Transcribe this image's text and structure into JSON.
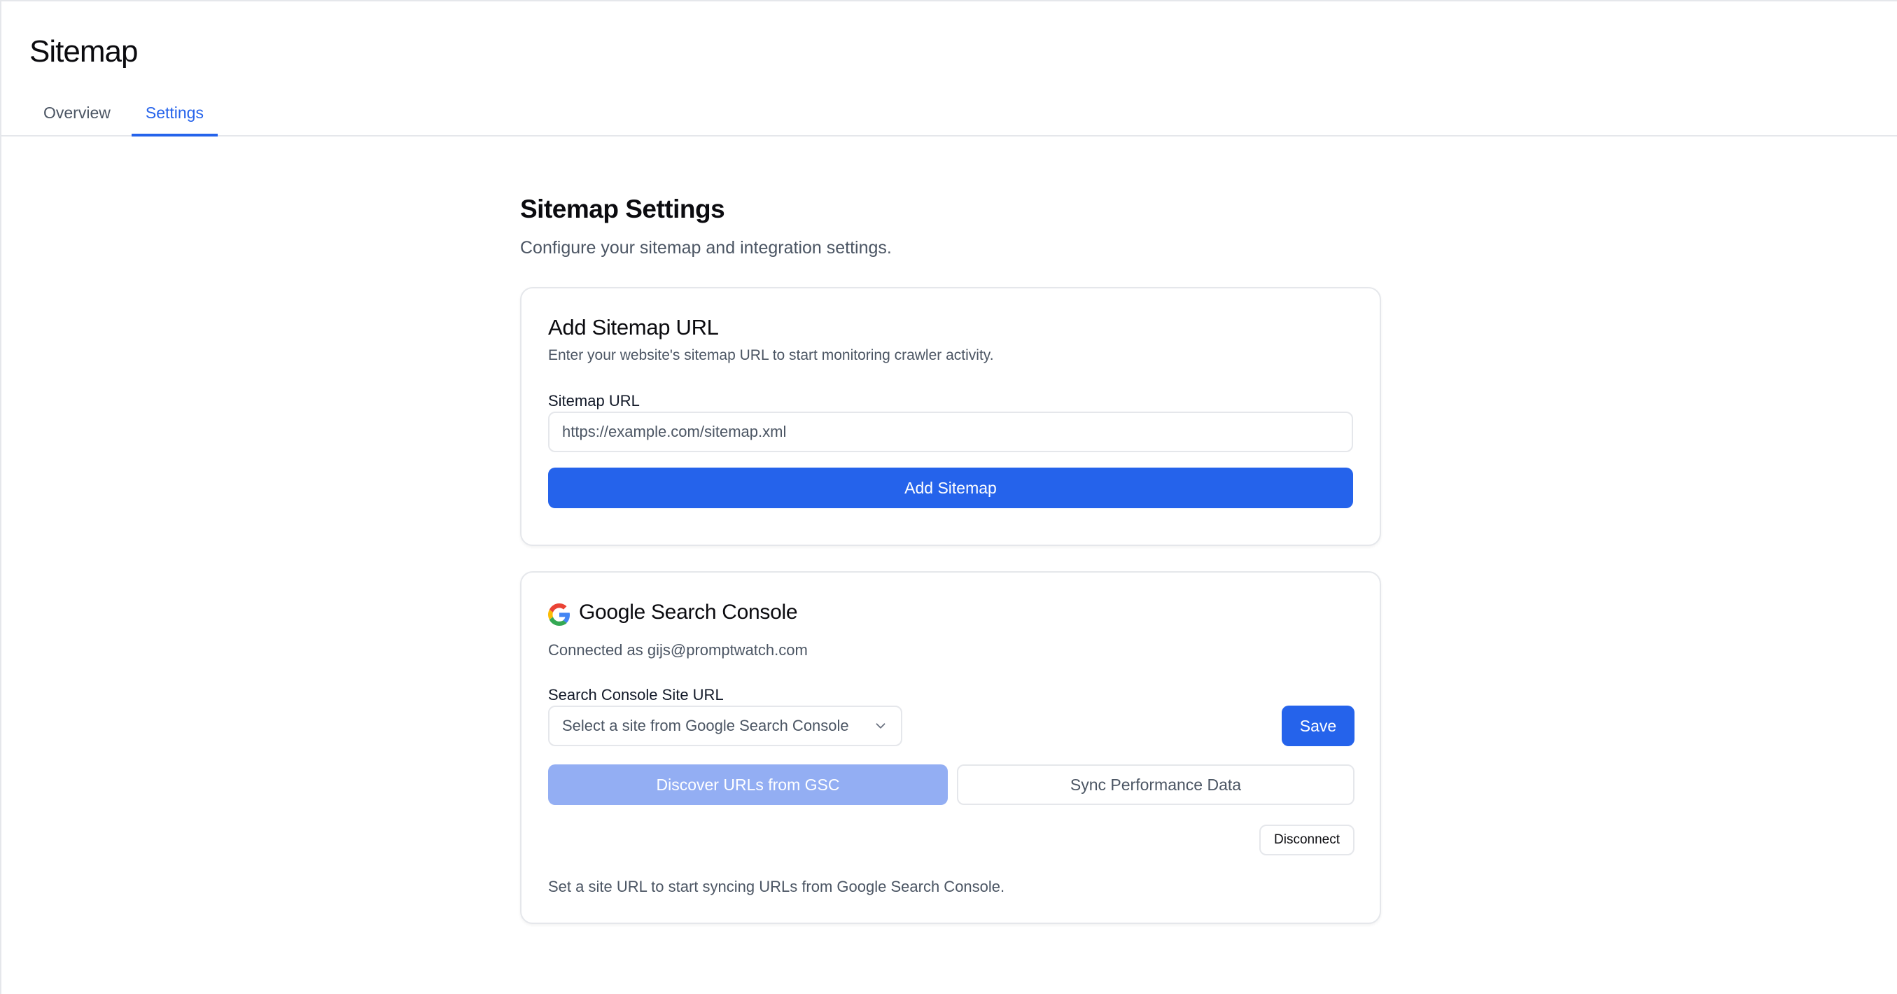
{
  "header": {
    "title": "Sitemap",
    "tabs": [
      {
        "label": "Overview",
        "active": false
      },
      {
        "label": "Settings",
        "active": true
      }
    ]
  },
  "main": {
    "title": "Sitemap Settings",
    "subtitle": "Configure your sitemap and integration settings."
  },
  "add_sitemap": {
    "title": "Add Sitemap URL",
    "description": "Enter your website's sitemap URL to start monitoring crawler activity.",
    "field_label": "Sitemap URL",
    "placeholder": "https://example.com/sitemap.xml",
    "button_label": "Add Sitemap"
  },
  "gsc": {
    "icon": "google-icon",
    "title": "Google Search Console",
    "connected_text": "Connected as gijs@promptwatch.com",
    "field_label": "Search Console Site URL",
    "select_placeholder": "Select a site from Google Search Console",
    "save_label": "Save",
    "discover_label": "Discover URLs from GSC",
    "sync_label": "Sync Performance Data",
    "disconnect_label": "Disconnect",
    "hint": "Set a site URL to start syncing URLs from Google Search Console."
  },
  "colors": {
    "accent": "#2563eb",
    "accent_disabled": "#93aef3",
    "border": "#e5e7eb",
    "muted_text": "#4b5563"
  }
}
